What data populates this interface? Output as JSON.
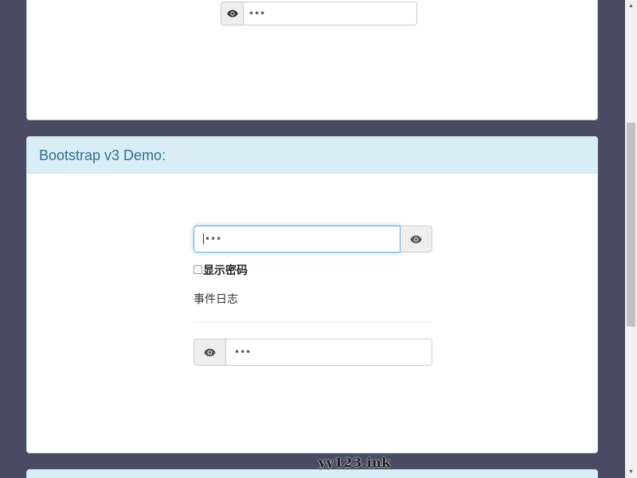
{
  "panel_top": {
    "password_masked": "•••"
  },
  "panel_demo": {
    "title": "Bootstrap v3 Demo:",
    "password_masked": "•••",
    "show_password_label": "显示密码",
    "event_log_label": "事件日志",
    "second_password_masked": "•••"
  },
  "icons": {
    "eye": "eye-icon"
  },
  "colors": {
    "background": "#4a4a63",
    "panel_heading": "#d9edf7",
    "panel_title": "#31708f",
    "focus_border": "#66afe9"
  },
  "watermark": "yy123.ink"
}
